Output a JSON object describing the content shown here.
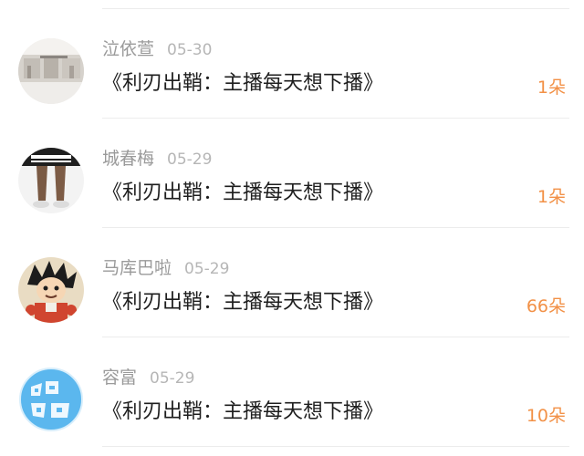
{
  "items": [
    {
      "name": "泣依萱",
      "date": "05-30",
      "title": "《利刃出鞘：主播每天想下播》",
      "count": "1朵",
      "avatar": "store-photo-avatar"
    },
    {
      "name": "城春梅",
      "date": "05-29",
      "title": "《利刃出鞘：主播每天想下播》",
      "count": "1朵",
      "avatar": "legs-photo-avatar"
    },
    {
      "name": "马库巴啦",
      "date": "05-29",
      "title": "《利刃出鞘：主播每天想下播》",
      "count": "66朵",
      "avatar": "cartoon-boy-avatar"
    },
    {
      "name": "容富",
      "date": "05-29",
      "title": "《利刃出鞘：主播每天想下播》",
      "count": "10朵",
      "avatar": "blue-badge-avatar"
    }
  ],
  "colors": {
    "count_orange": "#f29147",
    "name_gray": "#9a9a9a",
    "date_gray": "#b6b6b6",
    "title_black": "#1e1e1e",
    "divider": "#ececec"
  }
}
